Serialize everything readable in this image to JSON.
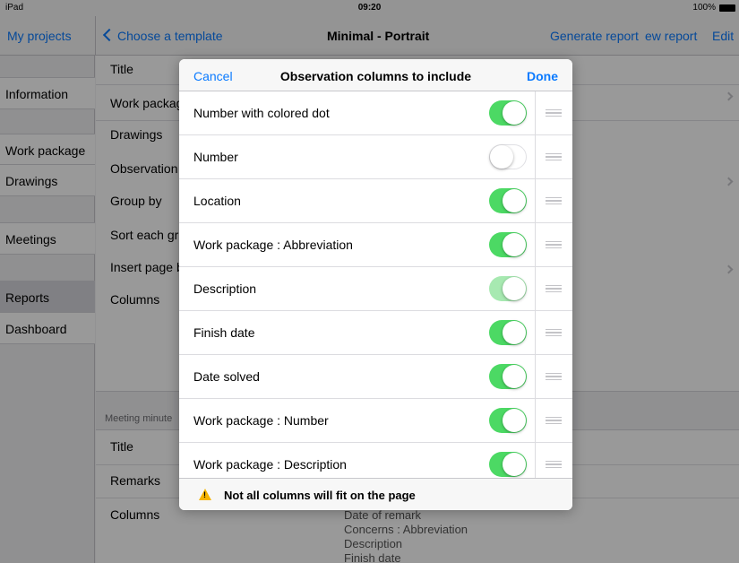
{
  "status_bar": {
    "device": "iPad",
    "time": "09:20",
    "battery": "100%"
  },
  "nav": {
    "left_button": "My projects",
    "back_label": "Choose a template",
    "title": "Minimal - Portrait",
    "generate": "Generate report",
    "new_report": "ew report",
    "edit": "Edit"
  },
  "sidebar": {
    "items": [
      {
        "label": "Information"
      },
      {
        "label": "Work package"
      },
      {
        "label": "Drawings"
      },
      {
        "label": "Meetings"
      },
      {
        "label": "Reports"
      },
      {
        "label": "Dashboard"
      }
    ]
  },
  "main": {
    "rows": [
      {
        "label": "Title"
      },
      {
        "label": "Work packag"
      },
      {
        "label": "Drawings"
      },
      {
        "label": "Observation"
      },
      {
        "label": "Group by"
      },
      {
        "label": "Sort each gr"
      },
      {
        "label": "Insert page b"
      },
      {
        "label": "Columns"
      }
    ],
    "meeting_header": "Meeting minute",
    "meeting_rows": [
      {
        "label": "Title"
      },
      {
        "label": "Remarks"
      },
      {
        "label": "Columns"
      }
    ],
    "column_values": [
      "Date of remark",
      "Concerns : Abbreviation",
      "Description",
      "Finish date"
    ]
  },
  "popover": {
    "cancel": "Cancel",
    "title": "Observation columns to include",
    "done": "Done",
    "rows": [
      {
        "label": "Number with colored dot",
        "state": "on"
      },
      {
        "label": "Number",
        "state": "off"
      },
      {
        "label": "Location",
        "state": "on"
      },
      {
        "label": "Work package : Abbreviation",
        "state": "on"
      },
      {
        "label": "Description",
        "state": "on-disabled"
      },
      {
        "label": "Finish date",
        "state": "on"
      },
      {
        "label": "Date solved",
        "state": "on"
      },
      {
        "label": "Work package : Number",
        "state": "on"
      },
      {
        "label": "Work package : Description",
        "state": "on"
      }
    ],
    "warning": "Not all columns will fit on the page"
  },
  "colors": {
    "accent": "#0a7aff",
    "toggle_on": "#4cd964",
    "warning": "#f6b400"
  },
  "icons": [
    "back-chevron-icon",
    "drag-handle-icon",
    "warning-icon",
    "disclosure-chevron-icon"
  ]
}
